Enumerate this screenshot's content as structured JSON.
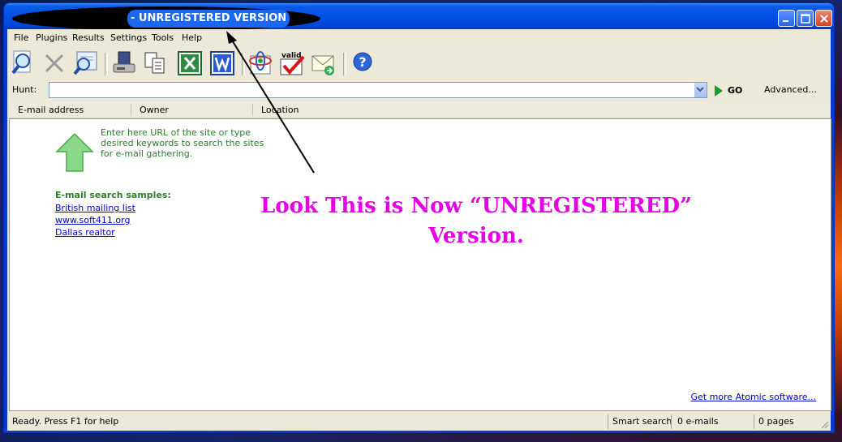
{
  "window": {
    "title": "- UNREGISTERED VERSION"
  },
  "menu": [
    "File",
    "Plugins",
    "Results",
    "Settings",
    "Tools",
    "Help"
  ],
  "toolbar": {
    "icons": [
      "search-icon",
      "stop-icon",
      "find-icon",
      "save-icon",
      "copy-icon",
      "excel-icon",
      "word-icon",
      "atom-icon",
      "validate-icon",
      "mail-icon",
      "help-icon"
    ],
    "validate_label": "valid"
  },
  "hunt": {
    "label": "Hunt:",
    "value": "",
    "go_label": "GO",
    "advanced_label": "Advanced..."
  },
  "columns": [
    "E-mail address",
    "Owner",
    "Location"
  ],
  "hint": "Enter here URL of the site or type desired keywords to search the sites for e-mail gathering.",
  "samples": {
    "title": "E-mail search samples:",
    "links": [
      "British mailing list",
      "www.soft411.org",
      "Dallas realtor"
    ]
  },
  "annotation": {
    "line1": "Look This is Now “UNREGISTERED”",
    "line2": "Version."
  },
  "more_link": "Get more Atomic software...",
  "status": {
    "ready": "Ready. Press F1 for help",
    "mode": "Smart search",
    "emails": "0 e-mails",
    "pages": "0 pages"
  },
  "colors": {
    "annotation": "#e500e5",
    "hint": "#2d7d2d",
    "link": "#0000cc",
    "titlebar": "#0050e4"
  }
}
